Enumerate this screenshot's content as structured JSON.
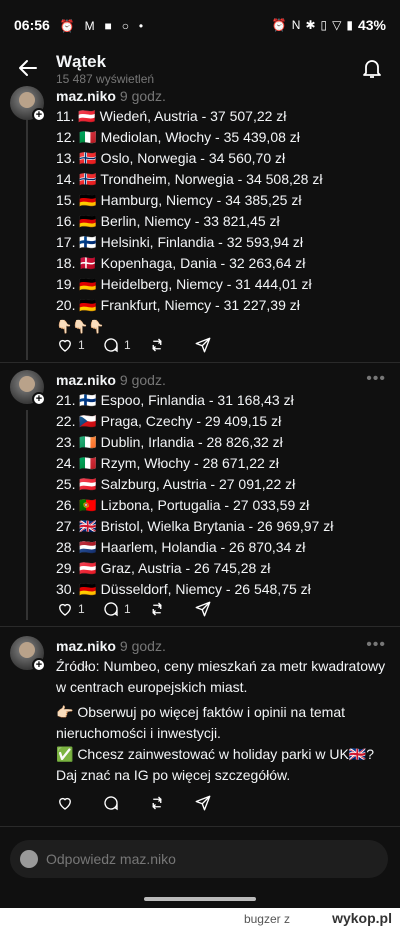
{
  "status_bar": {
    "time": "06:56",
    "left_icons": [
      "⏰",
      "M",
      "■",
      "○",
      "•"
    ],
    "right_icons": [
      "⏰",
      "N",
      "✱",
      "▯",
      "▽"
    ],
    "battery": "43%"
  },
  "header": {
    "title": "Wątek",
    "subtitle": "15 487 wyświetleń"
  },
  "post1": {
    "author": "maz.niko",
    "time": "9 godz.",
    "lines": [
      "11. 🇦🇹 Wiedeń, Austria - 37 507,22 zł",
      "12. 🇮🇹 Mediolan, Włochy - 35 439,08 zł",
      "13. 🇳🇴 Oslo, Norwegia - 34 560,70 zł",
      "14. 🇳🇴 Trondheim, Norwegia - 34 508,28 zł",
      "15. 🇩🇪 Hamburg, Niemcy - 34 385,25 zł",
      "16. 🇩🇪 Berlin, Niemcy - 33 821,45 zł",
      "17. 🇫🇮 Helsinki, Finlandia - 32 593,94 zł",
      "18. 🇩🇰 Kopenhaga, Dania - 32 263,64 zł",
      "19. 🇩🇪 Heidelberg, Niemcy - 31 444,01 zł",
      "20. 🇩🇪 Frankfurt, Niemcy - 31 227,39 zł",
      "👇🏻👇🏻👇🏻"
    ],
    "likes": "1",
    "replies": "1"
  },
  "post2": {
    "author": "maz.niko",
    "time": "9 godz.",
    "lines": [
      "21. 🇫🇮 Espoo, Finlandia - 31 168,43 zł",
      "22. 🇨🇿 Praga, Czechy - 29 409,15 zł",
      "23. 🇮🇪 Dublin, Irlandia - 28 826,32 zł",
      "24. 🇮🇹 Rzym, Włochy - 28 671,22 zł",
      "25. 🇦🇹 Salzburg, Austria - 27 091,22 zł",
      "26. 🇵🇹 Lizbona, Portugalia - 27 033,59 zł",
      "27. 🇬🇧 Bristol, Wielka Brytania - 26 969,97 zł",
      "28. 🇳🇱 Haarlem, Holandia - 26 870,34 zł",
      "29. 🇦🇹 Graz, Austria - 26 745,28 zł",
      "30. 🇩🇪 Düsseldorf, Niemcy - 26 548,75 zł"
    ],
    "likes": "1",
    "replies": "1"
  },
  "post3": {
    "author": "maz.niko",
    "time": "9 godz.",
    "para1": "Źródło: Numbeo, ceny mieszkań za metr kwadratowy w centrach europejskich miast.",
    "para2": "👉🏻 Obserwuj po więcej faktów i opinii na temat nieruchomości i inwestycji.",
    "para3": "✅ Chcesz zainwestować w holiday parki w UK🇬🇧? Daj znać na IG po więcej szczegółów."
  },
  "reply": {
    "placeholder": "Odpowiedz maz.niko"
  },
  "footer": {
    "user": "bugzer",
    "z": "z",
    "logo": "wykop.pl"
  },
  "colors": {
    "background": "#101010",
    "text": "#f3f5f7",
    "muted": "#777777"
  }
}
